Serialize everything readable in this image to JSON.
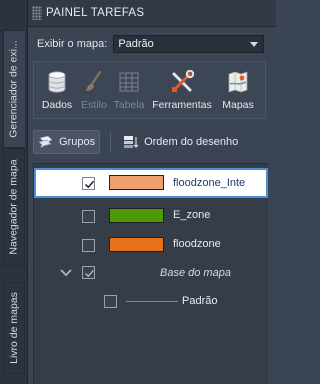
{
  "header": {
    "title": "PAINEL TAREFAS"
  },
  "side_tabs": [
    {
      "label": "Gerenciador de exi..."
    },
    {
      "label": "Navegador de mapa"
    },
    {
      "label": "Livro de mapas"
    }
  ],
  "map_selector": {
    "label": "Exibir o mapa:",
    "value": "Padrão"
  },
  "toolbar": {
    "items": [
      {
        "label": "Dados",
        "icon": "database-icon",
        "enabled": true
      },
      {
        "label": "Estilo",
        "icon": "brush-icon",
        "enabled": false
      },
      {
        "label": "Tabela",
        "icon": "table-icon",
        "enabled": false
      },
      {
        "label": "Ferramentas",
        "icon": "tools-icon",
        "enabled": true
      },
      {
        "label": "Mapas",
        "icon": "maps-icon",
        "enabled": true
      }
    ]
  },
  "view_tabs": {
    "groups_label": "Grupos",
    "draw_order_label": "Ordem do desenho"
  },
  "layers": [
    {
      "name": "floodzone_Inte",
      "checked": true,
      "color": "#f0a070",
      "selected": true
    },
    {
      "name": "E_zone",
      "checked": false,
      "color": "#4e9a06"
    },
    {
      "name": "floodzone",
      "checked": false,
      "color": "#e8711c"
    }
  ],
  "base_group": {
    "name": "Base do mapa",
    "checked": true,
    "expanded": true
  },
  "base_layers": [
    {
      "name": "Padrão",
      "checked": false
    }
  ],
  "colors": {
    "accent": "#4b8fd6",
    "panel": "#3b4453"
  }
}
